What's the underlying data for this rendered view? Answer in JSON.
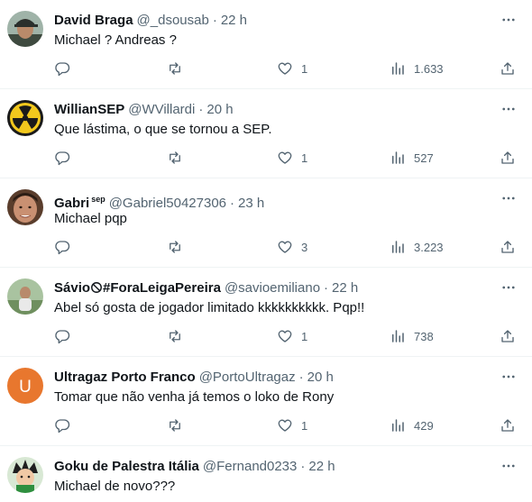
{
  "tweets": [
    {
      "name": "David Braga",
      "badge": "",
      "handle": "@_dsousab",
      "time": "22 h",
      "text": "Michael ? Andreas ?",
      "likes": "1",
      "views": "1.633",
      "avatar": "photo-man-cap"
    },
    {
      "name": "WillianSEP",
      "badge": "",
      "handle": "@WVillardi",
      "time": "20 h",
      "text": "Que lástima, o que se tornou a SEP.",
      "likes": "1",
      "views": "527",
      "avatar": "radiation-symbol"
    },
    {
      "name": "Gabri",
      "badge": "sep",
      "handle": "@Gabriel50427306",
      "time": "23 h",
      "text": "Michael pqp",
      "likes": "3",
      "views": "3.223",
      "avatar": "photo-man-face"
    },
    {
      "name": "Sávio",
      "name_suffix": "#ForaLeigaPereira",
      "badge": "",
      "handle": "@savioemiliano",
      "time": "22 h",
      "text": "Abel só gosta de jogador limitado kkkkkkkkkk. Pqp!!",
      "likes": "1",
      "views": "738",
      "avatar": "photo-person-outdoor"
    },
    {
      "name": "Ultragaz Porto Franco",
      "badge": "",
      "handle": "@PortoUltragaz",
      "time": "20 h",
      "text": "Tomar que não venha já temos o loko de Rony",
      "likes": "1",
      "views": "429",
      "avatar_letter": "U",
      "avatar": "letter-orange"
    },
    {
      "name": "Goku de Palestra Itália",
      "badge": "",
      "handle": "@Fernand0233",
      "time": "22 h",
      "text": "Michael de novo???",
      "avatar": "anime-character"
    }
  ],
  "colors": {
    "secondary_text": "#536471",
    "primary_text": "#0f1419",
    "divider": "#eff3f4",
    "letter_avatar": "#e8772e"
  },
  "icons": [
    "reply-icon",
    "retweet-icon",
    "like-icon",
    "views-icon",
    "share-icon",
    "more-options-icon"
  ]
}
